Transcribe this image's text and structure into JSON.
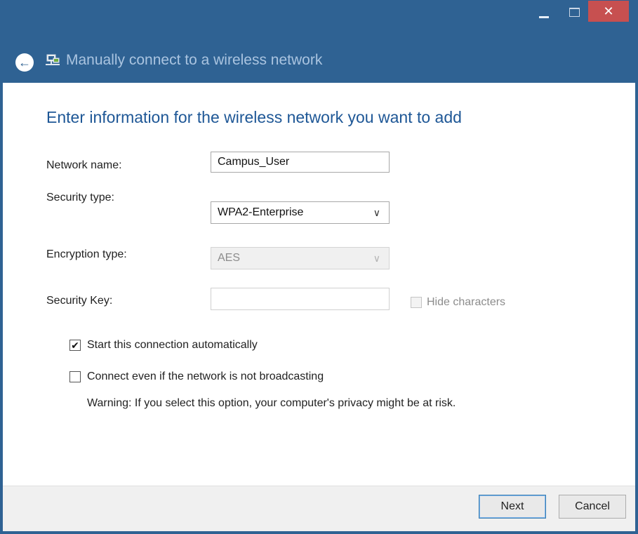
{
  "window": {
    "title": "Manually connect to a wireless network",
    "close_glyph": "✕",
    "back_glyph": "←"
  },
  "form": {
    "heading": "Enter information for the wireless network you want to add",
    "network_name": {
      "label": "Network name:",
      "value": "Campus_User"
    },
    "security_type": {
      "label": "Security type:",
      "value": "WPA2-Enterprise"
    },
    "encryption_type": {
      "label": "Encryption type:",
      "value": "AES"
    },
    "security_key": {
      "label": "Security Key:",
      "value": ""
    },
    "hide_characters": {
      "label": "Hide characters",
      "checked": false
    },
    "start_automatically": {
      "label": "Start this connection automatically",
      "checked": true,
      "mark": "✔"
    },
    "connect_not_broadcasting": {
      "label": "Connect even if the network is not broadcasting",
      "checked": false
    },
    "warning": "Warning: If you select this option, your computer's privacy might be at risk."
  },
  "buttons": {
    "next": "Next",
    "cancel": "Cancel"
  },
  "icons": {
    "chevron": "∨",
    "minimize": "minimize-icon",
    "maximize": "maximize-icon",
    "close": "close-icon",
    "back": "back-arrow-icon",
    "network": "network-icon"
  },
  "colors": {
    "titlebar": "#2f6293",
    "heading": "#1e5796",
    "close": "#c75050"
  }
}
